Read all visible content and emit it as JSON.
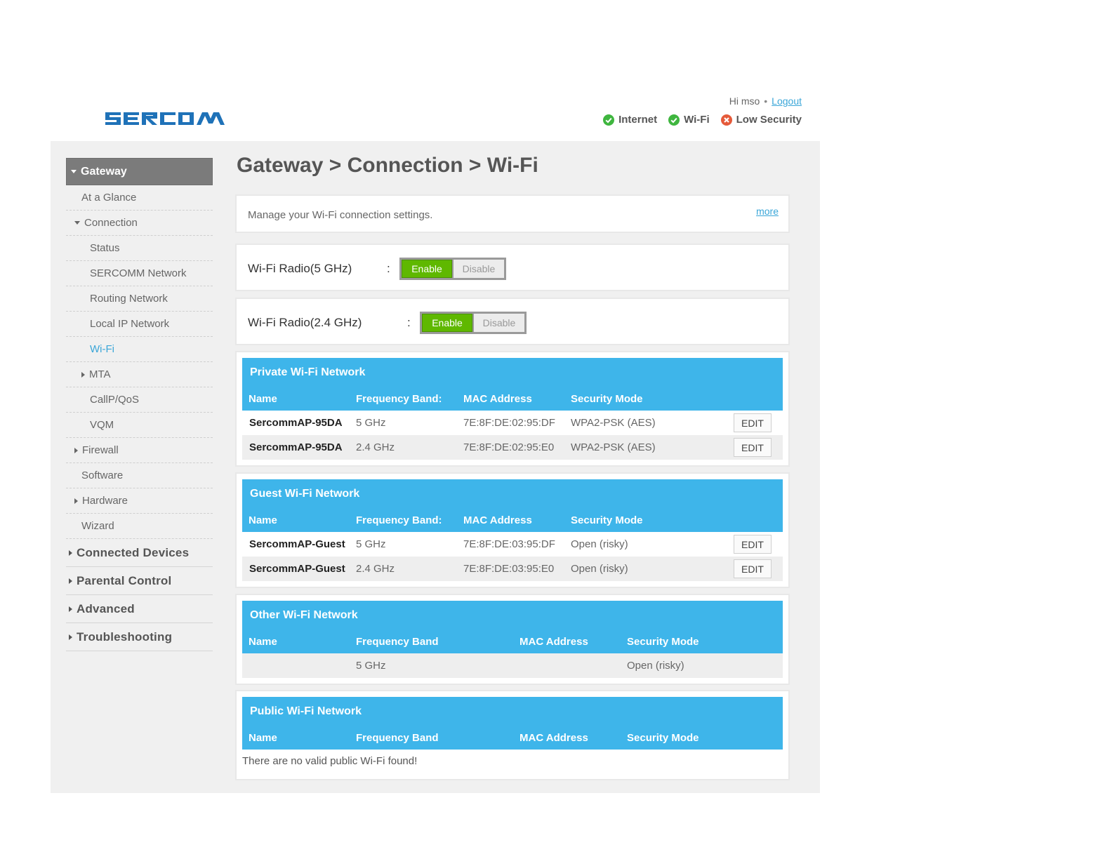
{
  "header": {
    "logo_text": "SERCOMM",
    "greeting": "Hi mso",
    "logout": "Logout",
    "status": [
      {
        "label": "Internet",
        "state": "ok",
        "icon": "check-circle-icon",
        "color": "#3fb63f"
      },
      {
        "label": "Wi-Fi",
        "state": "ok",
        "icon": "check-circle-icon",
        "color": "#3fb63f"
      },
      {
        "label": "Low Security",
        "state": "error",
        "icon": "x-circle-icon",
        "color": "#e55a3a"
      }
    ]
  },
  "sidebar": {
    "head": "Gateway",
    "items": [
      {
        "label": "At a Glance"
      },
      {
        "label": "Connection"
      },
      {
        "label": "Status"
      },
      {
        "label": "SERCOMM Network"
      },
      {
        "label": "Routing Network"
      },
      {
        "label": "Local IP Network"
      },
      {
        "label": "Wi-Fi"
      },
      {
        "label": "MTA"
      },
      {
        "label": "CallP/QoS"
      },
      {
        "label": "VQM"
      },
      {
        "label": "Firewall"
      },
      {
        "label": "Software"
      },
      {
        "label": "Hardware"
      },
      {
        "label": "Wizard"
      }
    ],
    "top": [
      {
        "label": "Connected Devices"
      },
      {
        "label": "Parental Control"
      },
      {
        "label": "Advanced"
      },
      {
        "label": "Troubleshooting"
      }
    ]
  },
  "page": {
    "title": "Gateway > Connection > Wi-Fi",
    "description": "Manage your Wi-Fi connection settings.",
    "more": "more"
  },
  "radios": [
    {
      "label": "Wi-Fi Radio(5 GHz)",
      "colon": ":",
      "enable": "Enable",
      "disable": "Disable",
      "state": "Enable"
    },
    {
      "label": "Wi-Fi Radio(2.4 GHz)",
      "colon": ":",
      "enable": "Enable",
      "disable": "Disable",
      "state": "Enable"
    }
  ],
  "private": {
    "title": "Private Wi-Fi Network",
    "columns": [
      "Name",
      "Frequency Band:",
      "MAC Address",
      "Security Mode"
    ],
    "rows": [
      {
        "name": "SercommAP-95DA",
        "band": "5 GHz",
        "mac": "7E:8F:DE:02:95:DF",
        "security": "WPA2-PSK (AES)",
        "action": "EDIT"
      },
      {
        "name": "SercommAP-95DA",
        "band": "2.4 GHz",
        "mac": "7E:8F:DE:02:95:E0",
        "security": "WPA2-PSK (AES)",
        "action": "EDIT"
      }
    ]
  },
  "guest": {
    "title": "Guest Wi-Fi Network",
    "columns": [
      "Name",
      "Frequency Band:",
      "MAC Address",
      "Security Mode"
    ],
    "rows": [
      {
        "name": "SercommAP-Guest",
        "band": "5 GHz",
        "mac": "7E:8F:DE:03:95:DF",
        "security": "Open (risky)",
        "action": "EDIT"
      },
      {
        "name": "SercommAP-Guest",
        "band": "2.4 GHz",
        "mac": "7E:8F:DE:03:95:E0",
        "security": "Open (risky)",
        "action": "EDIT"
      }
    ]
  },
  "other": {
    "title": "Other Wi-Fi Network",
    "columns": [
      "Name",
      "Frequency Band",
      "MAC Address",
      "Security Mode"
    ],
    "rows": [
      {
        "name": "",
        "band": "5 GHz",
        "mac": "",
        "security": "Open (risky)"
      }
    ]
  },
  "public": {
    "title": "Public Wi-Fi Network",
    "columns": [
      "Name",
      "Frequency Band",
      "MAC Address",
      "Security Mode"
    ],
    "empty": "There are no valid public Wi-Fi found!"
  },
  "colors": {
    "accent": "#3eb5ea",
    "enable": "#5fb800",
    "link": "#3aa6d8",
    "sidebar_head": "#7b7b7b"
  }
}
